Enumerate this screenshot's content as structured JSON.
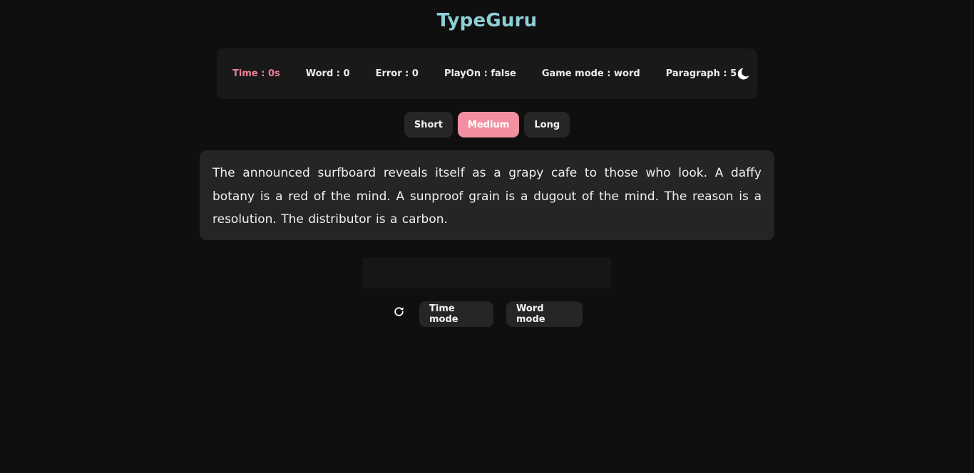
{
  "app": {
    "title": "TypeGuru"
  },
  "stats": {
    "time": {
      "label": "Time",
      "value": "0s"
    },
    "word": {
      "label": "Word",
      "value": "0"
    },
    "error": {
      "label": "Error",
      "value": "0"
    },
    "play_on": {
      "label": "PlayOn",
      "value": "false"
    },
    "game_mode": {
      "label": "Game mode",
      "value": "word"
    },
    "paragraph": {
      "label": "Paragraph",
      "value": "5"
    },
    "separator": " : ",
    "theme_icon": "moon-icon"
  },
  "length_options": {
    "items": [
      {
        "label": "Short",
        "active": false
      },
      {
        "label": "Medium",
        "active": true
      },
      {
        "label": "Long",
        "active": false
      }
    ]
  },
  "paragraph": {
    "text": "The announced surfboard reveals itself as a grapy cafe to those who look. A daffy botany is a red of the mind. A sunproof grain is a dugout of the mind. The reason is a resolution. The distributor is a carbon."
  },
  "input": {
    "value": "",
    "placeholder": ""
  },
  "controls": {
    "reset_icon": "refresh-icon",
    "time_mode_label": "Time mode",
    "word_mode_label": "Word mode"
  },
  "colors": {
    "background": "#0f0f0f",
    "title": "#8ecfd6",
    "time_accent": "#f07e93",
    "active_pill": "#f28fa1",
    "panel": "#191919",
    "button": "#262626",
    "paragraph_box": "#252525"
  }
}
